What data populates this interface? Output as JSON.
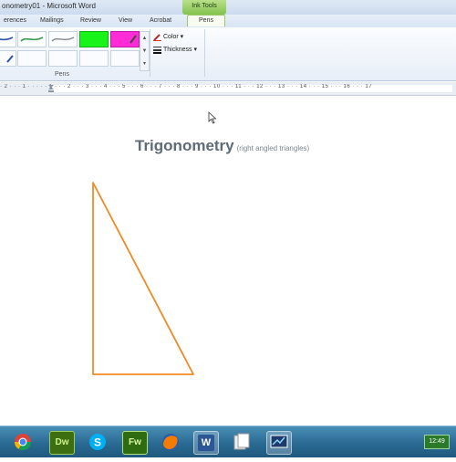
{
  "window": {
    "title": "onometry01 - Microsoft Word",
    "contextual_group": "Ink Tools"
  },
  "tabs": [
    {
      "label": "erences"
    },
    {
      "label": "Mailings"
    },
    {
      "label": "Review"
    },
    {
      "label": "View"
    },
    {
      "label": "Acrobat"
    },
    {
      "label": "Pens"
    }
  ],
  "ribbon": {
    "group_label": "Pens",
    "color_label": "Color",
    "thickness_label": "Thickness",
    "highlighter_colors": [
      "#18f41a",
      "#ff2bd6"
    ]
  },
  "ruler": {
    "numbers": "· 2 · · · 1 · · · · · 1 · · · 2 · · · 3 · · · 4 · · · 5 · · · 6 · · · 7 · · · 8 · · · 9 · · · 10 · · · 11 · · · 12 · · · 13 · · · 14 · · · 15 · · · 16 · · · 17"
  },
  "document": {
    "title": "Trigonometry",
    "subtitle": "(right angled triangles)",
    "triangle_color": "#f08a24"
  },
  "taskbar": {
    "apps": [
      {
        "name": "chrome-icon"
      },
      {
        "name": "dreamweaver-icon",
        "label": "Dw"
      },
      {
        "name": "skype-icon"
      },
      {
        "name": "fireworks-icon",
        "label": "Fw"
      },
      {
        "name": "firefox-icon"
      },
      {
        "name": "word-icon",
        "label": "W"
      },
      {
        "name": "files-icon"
      },
      {
        "name": "presentation-icon"
      }
    ],
    "clock": "12:49"
  }
}
